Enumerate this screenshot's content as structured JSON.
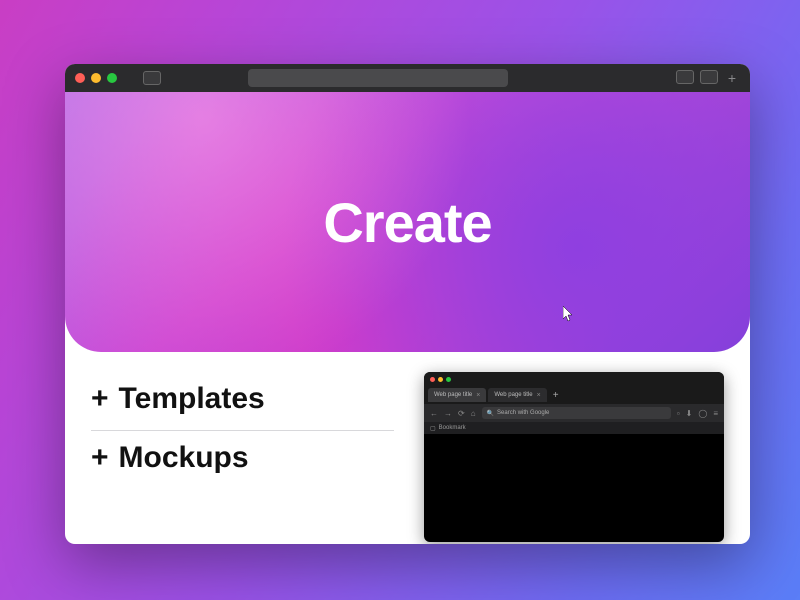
{
  "hero": {
    "title": "Create"
  },
  "features": [
    {
      "prefix": "+",
      "label": "Templates"
    },
    {
      "prefix": "+",
      "label": "Mockups"
    }
  ],
  "mockup": {
    "tabs": [
      {
        "label": "Web page title",
        "active": true
      },
      {
        "label": "Web page title",
        "active": false
      }
    ],
    "search_placeholder": "Search with Google",
    "bookmark_label": "Bookmark"
  }
}
